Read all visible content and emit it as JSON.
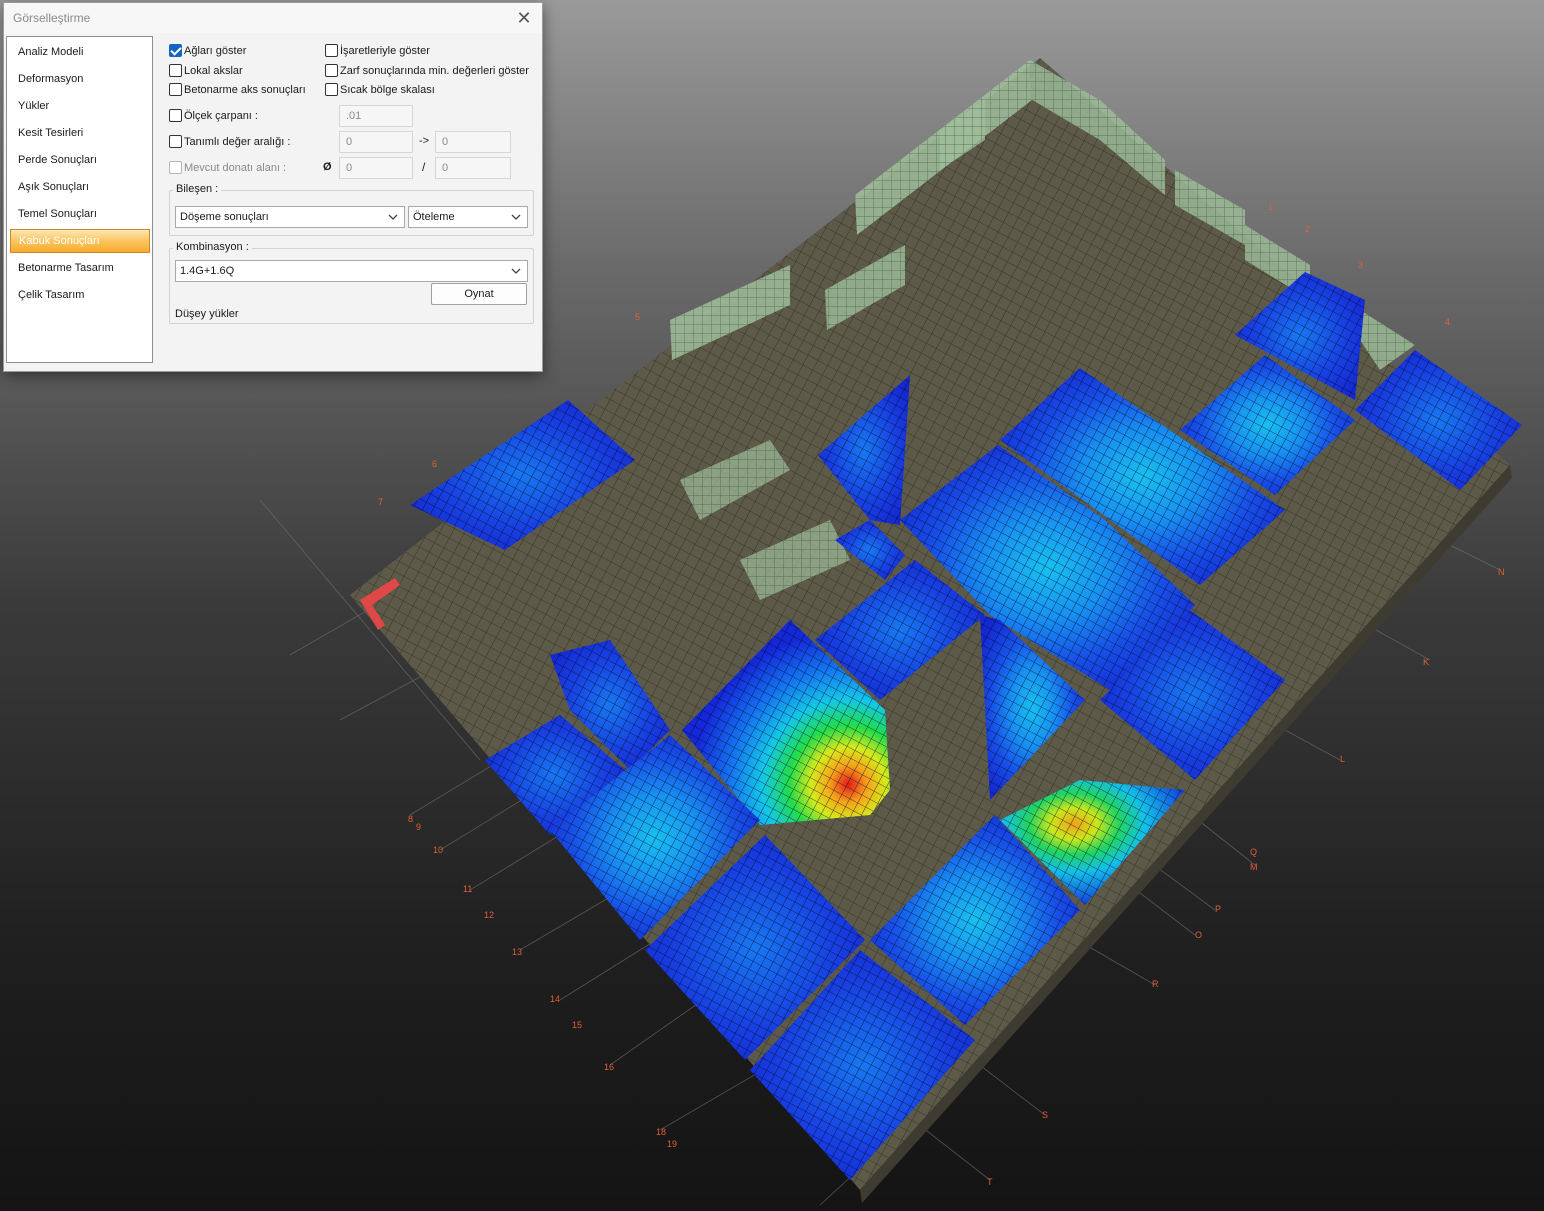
{
  "dialog": {
    "title": "Görselleştirme",
    "close": "✕"
  },
  "nav": {
    "items": [
      {
        "label": "Analiz Modeli"
      },
      {
        "label": "Deformasyon"
      },
      {
        "label": "Yükler"
      },
      {
        "label": "Kesit Tesirleri"
      },
      {
        "label": "Perde Sonuçları"
      },
      {
        "label": "Aşık Sonuçları"
      },
      {
        "label": "Temel Sonuçları"
      },
      {
        "label": "Kabuk Sonuçları",
        "active": true
      },
      {
        "label": "Betonarme Tasarım"
      },
      {
        "label": "Çelik Tasarım"
      }
    ]
  },
  "options": {
    "show_mesh": {
      "label": "Ağları göster",
      "checked": true
    },
    "local_axes": {
      "label": "Lokal akslar",
      "checked": false
    },
    "rc_axis_results": {
      "label": "Betonarme aks sonuçları",
      "checked": false
    },
    "show_with_signs": {
      "label": "İşaretleriyle göster",
      "checked": false
    },
    "envelope_min": {
      "label": "Zarf sonuçlarında min. değerleri göster",
      "checked": false
    },
    "hot_zone_scale": {
      "label": "Sıcak bölge skalası",
      "checked": false
    },
    "scale_factor": {
      "label": "Ölçek çarpanı :",
      "checked": false,
      "value": ".01"
    },
    "defined_range": {
      "label": "Tanımlı değer aralığı :",
      "checked": false,
      "from": "0",
      "arrow": "->",
      "to": "0"
    },
    "existing_rebar": {
      "label": "Mevcut donatı alanı :",
      "checked": false,
      "disabled": true,
      "diameter_symbol": "Ø",
      "diameter": "0",
      "slash": "/",
      "spacing": "0"
    }
  },
  "component": {
    "label": "Bileşen :",
    "result_type": "Döşeme sonuçları",
    "quantity": "Öteleme"
  },
  "combination": {
    "label": "Kombinasyon :",
    "value": "1.4G+1.6Q",
    "play_label": "Oynat",
    "status": "Düşey yükler"
  },
  "axis_labels": [
    "K",
    "L",
    "M",
    "N",
    "O",
    "P",
    "Q",
    "R",
    "S",
    "T",
    "8",
    "9",
    "10",
    "11",
    "12",
    "13",
    "14",
    "15",
    "16",
    "18",
    "19",
    "1",
    "2",
    "3",
    "4",
    "5",
    "6",
    "7"
  ],
  "colors": {
    "accent": "#f7aa2c",
    "checkbox": "#1565c0",
    "slab": "#5d5a4a",
    "shell_blue": "#1428d8",
    "wall": "#9fbf9a",
    "axis_label": "#e0603a"
  }
}
